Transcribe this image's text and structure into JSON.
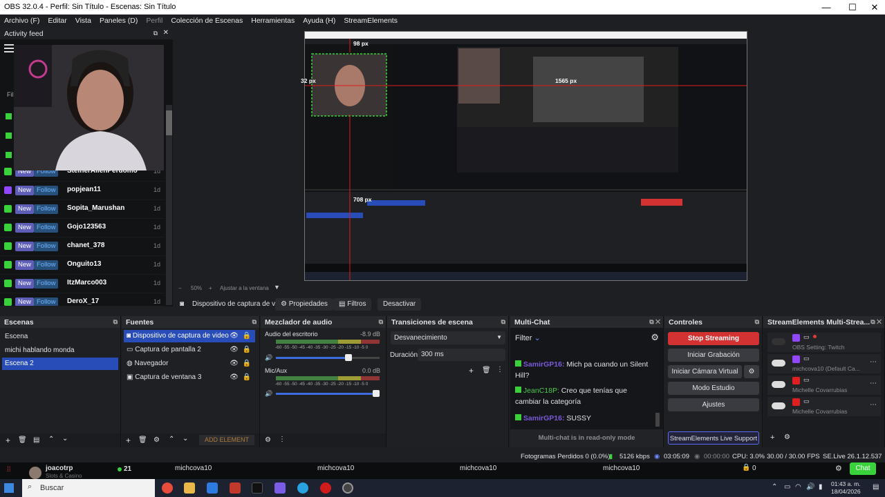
{
  "titlebar": {
    "title": "OBS 32.0.4 - Perfil: Sin Título - Escenas: Sin Título",
    "min": "—",
    "max": "☐",
    "close": "✕"
  },
  "menu": [
    "Archivo (F)",
    "Editar",
    "Vista",
    "Paneles (D)",
    "Perfil",
    "Colección de Escenas",
    "Herramientas",
    "Ayuda (H)",
    "StreamElements"
  ],
  "feed": {
    "title": "Activity feed",
    "badge_new": "New",
    "badge_follow": "Follow",
    "rows": [
      {
        "name": "SteinerAllenPerdomo",
        "time": "1d"
      },
      {
        "name": "popjean11",
        "time": "1d"
      },
      {
        "name": "Sopita_Marushan",
        "time": "1d"
      },
      {
        "name": "Gojo123563",
        "time": "1d"
      },
      {
        "name": "chanet_378",
        "time": "1d"
      },
      {
        "name": "Onguito13",
        "time": "1d"
      },
      {
        "name": "ItzMarco003",
        "time": "1d"
      },
      {
        "name": "DeroX_17",
        "time": "1d"
      }
    ]
  },
  "preview": {
    "label_px_top": "98 px",
    "label_px_left": "32 px",
    "label_px_right": "1565 px",
    "label_px_bottom": "708 px"
  },
  "zoom": {
    "value": "50%",
    "fit": "Ajustar a la ventana"
  },
  "sourcebar": {
    "source": "Dispositivo de captura de v",
    "props": "Propiedades",
    "filters": "Filtros",
    "deactivate": "Desactivar"
  },
  "scenes": {
    "title": "Escenas",
    "items": [
      "Escena",
      "michi hablando monda",
      "Escena 2"
    ]
  },
  "sources": {
    "title": "Fuentes",
    "items": [
      "Dispositivo de captura de video",
      "Captura de pantalla 2",
      "Navegador",
      "Captura de ventana 3"
    ],
    "add_element": "ADD ELEMENT"
  },
  "mixer": {
    "title": "Mezclador de audio",
    "ch1": {
      "name": "Audio del escritorio",
      "db": "-8.9 dB"
    },
    "ch2": {
      "name": "Mic/Aux",
      "db": "0.0 dB"
    },
    "ticks": "-60 -55 -50 -45 -40 -35 -30 -25 -20 -15 -10 -5 0",
    "ch1_volume": 0.73,
    "ch2_volume": 1.0
  },
  "transitions": {
    "title": "Transiciones de escena",
    "selected": "Desvanecimiento",
    "duration_label": "Duración",
    "duration_value": "300 ms"
  },
  "multichat": {
    "title": "Multi-Chat",
    "filter": "Filter",
    "messages": [
      {
        "user": "SamirGP16:",
        "text": "Mich pa cuando un Silent Hill?"
      },
      {
        "user": "JeanC18P:",
        "text": "Creo que tenías que cambiar la categoría"
      },
      {
        "user": "SamirGP16:",
        "text": "SUSSY"
      }
    ],
    "footer": "Multi-chat is in read-only mode"
  },
  "controls": {
    "title": "Controles",
    "buttons": [
      "Stop Streaming",
      "Iniciar Grabación",
      "Iniciar Cámara Virtual",
      "Modo Estudio",
      "Ajustes"
    ],
    "support": "StreamElements Live Support"
  },
  "multistream": {
    "title": "StreamElements Multi-Strea...",
    "rows": [
      {
        "label": "OBS Setting: Twitch"
      },
      {
        "label": "michcova10 (Default Ca..."
      },
      {
        "label": "Michelle Covarrubias"
      },
      {
        "label": "Michelle Covarrubias"
      }
    ]
  },
  "status": {
    "frames": "Fotogramas Perdidos 0 (0.0%)",
    "kbps": "5126 kbps",
    "live_time": "03:05:09",
    "rec_time": "00:00:00",
    "cpu": "CPU: 3.0%",
    "fps": "30.00 / 30.00 FPS",
    "version": "SE.Live 26.1.12.537"
  },
  "obsbottom": {
    "user": "joacotrp",
    "sub": "Slots & Casino",
    "viewers": "21",
    "chan1": "michcova10",
    "chan2": "michcova10",
    "chan3": "michcova10",
    "chan4": "michcova10",
    "zero": "0",
    "chat": "Chat"
  },
  "taskbar": {
    "search": "Buscar",
    "time": "01:43 a. m.",
    "date": "18/04/2026"
  },
  "colors": {
    "accent": "#284cb8",
    "stop": "#d23232",
    "live": "#3ad23a"
  }
}
